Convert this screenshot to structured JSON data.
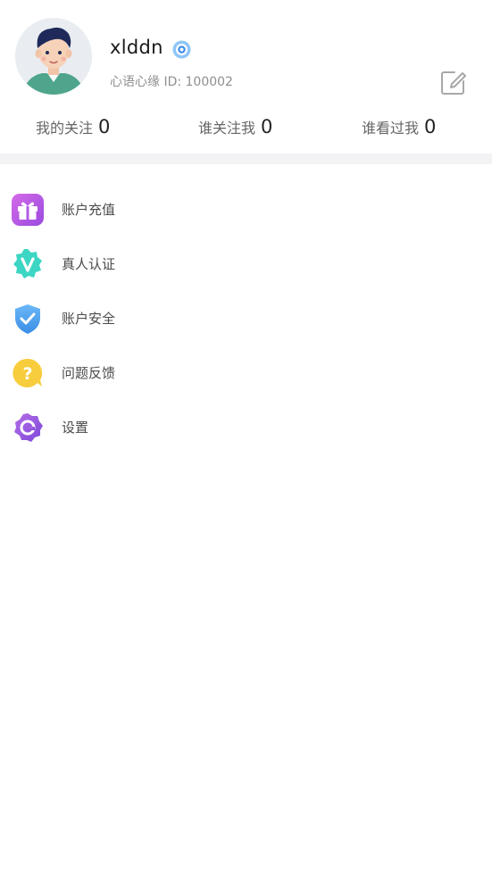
{
  "profile": {
    "username": "xlddn",
    "verified_icon": "verified-badge-icon",
    "id_text": "心语心缘 ID: 100002",
    "avatar_icon": "user-avatar",
    "edit_icon": "edit-icon"
  },
  "stats": [
    {
      "label": "我的关注",
      "count": "0"
    },
    {
      "label": "谁关注我",
      "count": "0"
    },
    {
      "label": "谁看过我",
      "count": "0"
    }
  ],
  "menu": [
    {
      "label": "账户充值",
      "icon": "gift-icon",
      "color": "#b25ce6"
    },
    {
      "label": "真人认证",
      "icon": "verified-v-icon",
      "color": "#38d4c4"
    },
    {
      "label": "账户安全",
      "icon": "shield-check-icon",
      "color": "#4aa3f0"
    },
    {
      "label": "问题反馈",
      "icon": "question-bubble-icon",
      "color": "#f5c93b"
    },
    {
      "label": "设置",
      "icon": "settings-gear-icon",
      "color": "#9b5de5"
    }
  ]
}
